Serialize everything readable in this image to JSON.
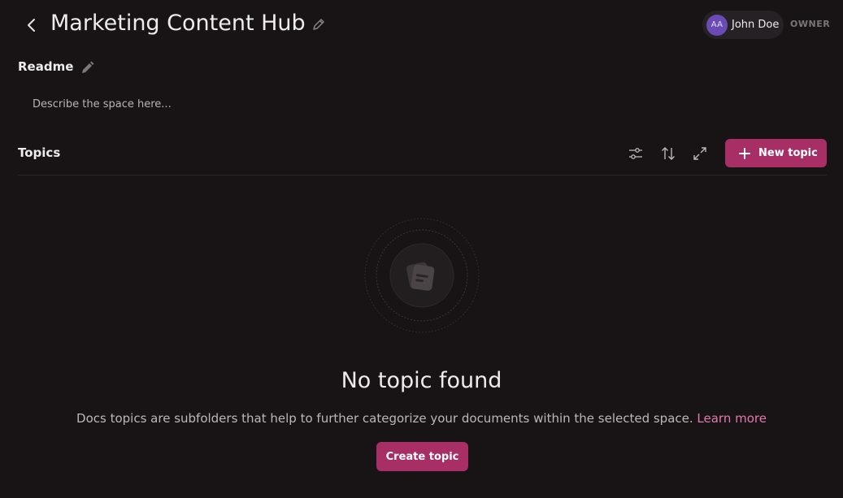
{
  "header": {
    "back_icon": "chevron-left-icon",
    "title": "Marketing Content Hub",
    "edit_icon": "pencil-outline-icon"
  },
  "user": {
    "initials": "AA",
    "name": "John Doe",
    "role": "OWNER",
    "avatar_color": "#6a4bb4"
  },
  "readme": {
    "title": "Readme",
    "edit_icon": "pencil-icon",
    "placeholder": "Describe the space here..."
  },
  "topics": {
    "title": "Topics",
    "toolbar": [
      {
        "icon": "filter-sliders-icon"
      },
      {
        "icon": "sort-arrows-icon"
      },
      {
        "icon": "expand-icon"
      }
    ],
    "new_topic_label": "New topic"
  },
  "empty_state": {
    "icon": "documents-icon",
    "title": "No topic found",
    "description": "Docs topics are subfolders that help to further categorize your documents within the selected space.",
    "learn_more": "Learn more",
    "create_label": "Create topic"
  },
  "colors": {
    "background": "#181416",
    "accent": "#a72f66",
    "link": "#e07aac"
  }
}
